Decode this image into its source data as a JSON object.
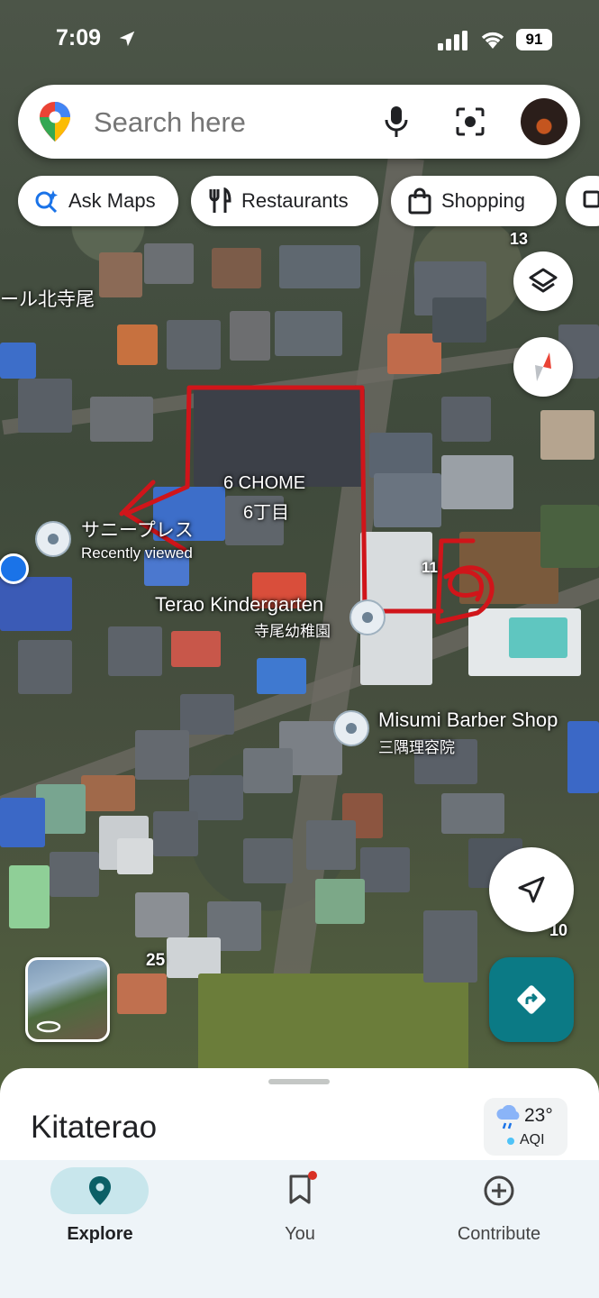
{
  "status_bar": {
    "time": "7:09",
    "battery": "91"
  },
  "search": {
    "placeholder": "Search here"
  },
  "chips": [
    {
      "label": "Ask Maps"
    },
    {
      "label": "Restaurants"
    },
    {
      "label": "Shopping"
    }
  ],
  "map": {
    "area_label_en": "6 CHOME",
    "area_label_ja": "6丁目",
    "partial_label_top": "ール北寺尾",
    "places": [
      {
        "name": "サニープレス",
        "subtitle": "Recently viewed"
      },
      {
        "name": "Terao Kindergarten",
        "subtitle": "寺尾幼稚園"
      },
      {
        "name": "Misumi Barber Shop",
        "subtitle": "三隅理容院"
      }
    ],
    "numbers": {
      "n13": "13",
      "n11": "11",
      "n25": "25",
      "n10": "10"
    }
  },
  "sheet": {
    "title": "Kitaterao",
    "weather": {
      "temp": "23°",
      "aqi_label": "AQI"
    }
  },
  "bottom_nav": [
    {
      "label": "Explore"
    },
    {
      "label": "You"
    },
    {
      "label": "Contribute"
    }
  ],
  "colors": {
    "accent": "#0b7a85",
    "active_nav": "#c8e6ec",
    "annotation": "#d0151a"
  }
}
